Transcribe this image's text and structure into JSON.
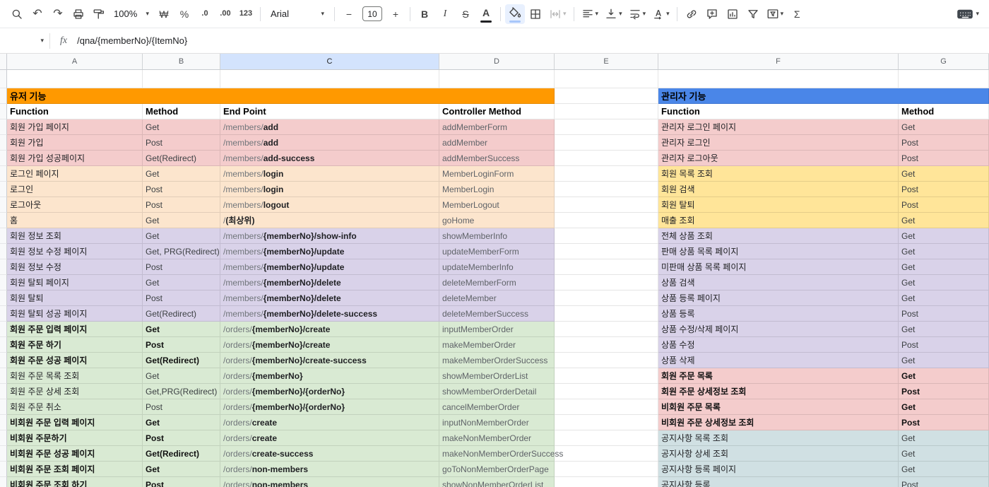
{
  "toolbar": {
    "items": [
      {
        "name": "search",
        "icon": "search"
      },
      {
        "name": "undo",
        "glyph": "↶",
        "cls": "arrow"
      },
      {
        "name": "redo",
        "glyph": "↷",
        "cls": "arrow"
      },
      {
        "name": "print",
        "icon": "print"
      },
      {
        "name": "paint-format",
        "icon": "roller"
      },
      {
        "name": "zoom",
        "label": "100%",
        "dropdown": true,
        "zoom": true
      },
      {
        "name": "format-currency",
        "glyph": "₩"
      },
      {
        "name": "format-percent",
        "glyph": "%"
      },
      {
        "name": "decrease-decimal-places",
        "glyph": ".0",
        "cls": "small"
      },
      {
        "name": "increase-decimal-places",
        "glyph": ".00",
        "cls": "small"
      },
      {
        "name": "more-formats",
        "glyph": "123",
        "cls": "small"
      },
      {
        "type": "sep"
      },
      {
        "name": "font-family",
        "label": "Arial",
        "dropdown": true,
        "wide": true
      },
      {
        "type": "sep"
      },
      {
        "name": "decrease-font-size",
        "glyph": "−"
      },
      {
        "name": "font-size",
        "box": "10"
      },
      {
        "name": "increase-font-size",
        "glyph": "+"
      },
      {
        "type": "sep"
      },
      {
        "name": "bold",
        "glyph": "B",
        "cls": "b"
      },
      {
        "name": "italic",
        "glyph": "I",
        "cls": "i"
      },
      {
        "name": "strikethrough",
        "glyph": "S",
        "cls": "s"
      },
      {
        "name": "text-color",
        "glyph": "A",
        "cls": "b",
        "bar": "#202124"
      },
      {
        "type": "sep"
      },
      {
        "name": "fill-color",
        "icon": "fill",
        "bar": "#a8c7fa",
        "active": true
      },
      {
        "name": "borders",
        "icon": "borders"
      },
      {
        "name": "merge-cells",
        "icon": "merge",
        "dropdown": true,
        "disabled": true
      },
      {
        "type": "sep"
      },
      {
        "name": "horizontal-align",
        "icon": "align-left",
        "dropdown": true
      },
      {
        "name": "vertical-align",
        "icon": "valign",
        "dropdown": true
      },
      {
        "name": "text-wrap",
        "icon": "wrap",
        "dropdown": true
      },
      {
        "name": "text-rotation",
        "icon": "rotate",
        "dropdown": true
      },
      {
        "type": "sep"
      },
      {
        "name": "insert-link",
        "icon": "link"
      },
      {
        "name": "insert-comment",
        "icon": "comment"
      },
      {
        "name": "insert-chart",
        "icon": "chart"
      },
      {
        "name": "create-filter",
        "icon": "filter"
      },
      {
        "name": "filter-views",
        "icon": "filter-views",
        "dropdown": true
      },
      {
        "name": "functions",
        "glyph": "Σ"
      },
      {
        "type": "spacer"
      },
      {
        "name": "input-tools",
        "icon": "keyboard",
        "dropdown": true
      }
    ]
  },
  "formula_bar": {
    "fx_label": "fx",
    "value": "/qna/{memberNo}/{ItemNo}"
  },
  "grid": {
    "columns": [
      "A",
      "B",
      "C",
      "D",
      "E",
      "F",
      "G"
    ],
    "selected_column": "C"
  },
  "left_table": {
    "section_title": "유저 기능",
    "section_color": "#ff9900",
    "headers": [
      "Function",
      "Method",
      "End Point",
      "Controller Method"
    ],
    "rows": [
      {
        "function": "회원 가입 페이지",
        "method": "Get",
        "endpoint_prefix": "/members/",
        "endpoint_main": "add",
        "controller": "addMemberForm",
        "color": "#f4cccc"
      },
      {
        "function": "회원 가입",
        "method": "Post",
        "endpoint_prefix": "/members/",
        "endpoint_main": "add",
        "controller": "addMember",
        "color": "#f4cccc"
      },
      {
        "function": "회원 가입 성공페이지",
        "method": "Get(Redirect)",
        "endpoint_prefix": "/members/",
        "endpoint_main": "add-success",
        "controller": "addMemberSuccess",
        "color": "#f4cccc"
      },
      {
        "function": "로그인 페이지",
        "method": "Get",
        "endpoint_prefix": "/members/",
        "endpoint_main": "login",
        "controller": "MemberLoginForm",
        "color": "#fce5cd"
      },
      {
        "function": "로그인",
        "method": "Post",
        "endpoint_prefix": "/members/",
        "endpoint_main": "login",
        "controller": "MemberLogin",
        "color": "#fce5cd"
      },
      {
        "function": "로그아웃",
        "method": "Post",
        "endpoint_prefix": "/members/",
        "endpoint_main": "logout",
        "controller": "MemberLogout",
        "color": "#fce5cd"
      },
      {
        "function": "홈",
        "method": "Get",
        "endpoint_prefix": "/ ",
        "endpoint_main": "(최상위)",
        "controller": "goHome",
        "color": "#fce5cd"
      },
      {
        "function": "회원 정보 조회",
        "method": "Get",
        "endpoint_prefix": "/members/",
        "endpoint_main": "{memberNo}/show-info",
        "controller": "showMemberInfo",
        "color": "#d9d2e9"
      },
      {
        "function": "회원 정보 수정 페이지",
        "method": "Get, PRG(Redirect)",
        "endpoint_prefix": "/members/",
        "endpoint_main": "{memberNo}/update",
        "controller": "updateMemberForm",
        "color": "#d9d2e9"
      },
      {
        "function": "회원 정보 수정",
        "method": "Post",
        "endpoint_prefix": "/members/",
        "endpoint_main": "{memberNo}/update",
        "controller": "updateMemberInfo",
        "color": "#d9d2e9"
      },
      {
        "function": "회원 탈퇴 페이지",
        "method": "Get",
        "endpoint_prefix": "/members/",
        "endpoint_main": "{memberNo}/delete",
        "controller": "deleteMemberForm",
        "color": "#d9d2e9"
      },
      {
        "function": "회원 탈퇴",
        "method": "Post",
        "endpoint_prefix": "/members/",
        "endpoint_main": "{memberNo}/delete",
        "controller": "deleteMember",
        "color": "#d9d2e9"
      },
      {
        "function": "회원 탈퇴 성공 페이지",
        "method": "Get(Redirect)",
        "endpoint_prefix": "/members/",
        "endpoint_main": "{memberNo}/delete-success",
        "controller": "deleteMemberSuccess",
        "color": "#d9d2e9"
      },
      {
        "function": "회원 주문 입력 페이지",
        "method": "Get",
        "endpoint_prefix": "/orders/",
        "endpoint_main": "{memberNo}/create",
        "controller": "inputMemberOrder",
        "color": "#d9ead3",
        "bold": true
      },
      {
        "function": "회원 주문 하기",
        "method": "Post",
        "endpoint_prefix": "/orders/",
        "endpoint_main": "{memberNo}/create",
        "controller": "makeMemberOrder",
        "color": "#d9ead3",
        "bold": true
      },
      {
        "function": "회원 주문 성공 페이지",
        "method": "Get(Redirect)",
        "endpoint_prefix": "/orders/",
        "endpoint_main": "{memberNo}/create-success",
        "controller": "makeMemberOrderSuccess",
        "color": "#d9ead3",
        "bold": true
      },
      {
        "function": "회원 주문 목록 조회",
        "method": "Get",
        "endpoint_prefix": "/orders/",
        "endpoint_main": "{memberNo}",
        "controller": "showMemberOrderList",
        "color": "#d9ead3"
      },
      {
        "function": "회원 주문 상세 조회",
        "method": "Get,PRG(Redirect)",
        "endpoint_prefix": "/orders/",
        "endpoint_main": "{memberNo}/{orderNo}",
        "controller": "showMemberOrderDetail",
        "color": "#d9ead3"
      },
      {
        "function": "회원 주문 취소",
        "method": "Post",
        "endpoint_prefix": "/orders/",
        "endpoint_main": "{memberNo}/{orderNo}",
        "controller": "cancelMemberOrder",
        "color": "#d9ead3"
      },
      {
        "function": "비회원 주문 입력 페이지",
        "method": "Get",
        "endpoint_prefix": "/orders/",
        "endpoint_main": "create",
        "controller": "inputNonMemberOrder",
        "color": "#d9ead3",
        "bold": true
      },
      {
        "function": "비회원 주문하기",
        "method": "Post",
        "endpoint_prefix": "/orders/",
        "endpoint_main": "create",
        "controller": "makeNonMemberOrder",
        "color": "#d9ead3",
        "bold": true
      },
      {
        "function": "비회원 주문 성공 페이지",
        "method": "Get(Redirect)",
        "endpoint_prefix": "/orders/",
        "endpoint_main": "create-success",
        "controller": "makeNonMemberOrderSuccess",
        "color": "#d9ead3",
        "bold": true
      },
      {
        "function": "비회원 주문 조회 페이지",
        "method": "Get",
        "endpoint_prefix": "/orders/",
        "endpoint_main": "non-members",
        "controller": "goToNonMemberOrderPage",
        "color": "#d9ead3",
        "bold": true
      },
      {
        "function": "비회원 주문 조회 하기",
        "method": "Post",
        "endpoint_prefix": "/orders/",
        "endpoint_main": "non-members",
        "controller": "showNonMemberOrderList",
        "color": "#d9ead3",
        "bold": true
      }
    ]
  },
  "right_table": {
    "section_title": "관리자 기능",
    "section_color": "#4a86e8",
    "headers": [
      "Function",
      "Method"
    ],
    "rows": [
      {
        "function": "관리자 로그인 페이지",
        "method": "Get",
        "color": "#f4cccc"
      },
      {
        "function": "관리자 로그인",
        "method": "Post",
        "color": "#f4cccc"
      },
      {
        "function": "관리자 로그아웃",
        "method": "Post",
        "color": "#f4cccc"
      },
      {
        "function": "회원 목록 조회",
        "method": "Get",
        "color": "#ffe599"
      },
      {
        "function": "회원 검색",
        "method": "Post",
        "color": "#ffe599"
      },
      {
        "function": "회원 탈퇴",
        "method": "Post",
        "color": "#ffe599"
      },
      {
        "function": "매출 조회",
        "method": "Get",
        "color": "#ffe599"
      },
      {
        "function": "전체 상품 조회",
        "method": "Get",
        "color": "#d9d2e9"
      },
      {
        "function": "판매 상품 목록 페이지",
        "method": "Get",
        "color": "#d9d2e9"
      },
      {
        "function": "미판매 상품 목록 페이지",
        "method": "Get",
        "color": "#d9d2e9"
      },
      {
        "function": "상품 검색",
        "method": "Get",
        "color": "#d9d2e9"
      },
      {
        "function": "상품 등록 페이지",
        "method": "Get",
        "color": "#d9d2e9"
      },
      {
        "function": "상품 등록",
        "method": "Post",
        "color": "#d9d2e9"
      },
      {
        "function": "상품 수정/삭제 페이지",
        "method": "Get",
        "color": "#d9d2e9"
      },
      {
        "function": "상품 수정",
        "method": "Post",
        "color": "#d9d2e9"
      },
      {
        "function": "상품 삭제",
        "method": "Get",
        "color": "#d9d2e9"
      },
      {
        "function": "회원 주문 목록",
        "method": "Get",
        "color": "#f4cccc",
        "bold": true
      },
      {
        "function": "회원 주문 상세정보 조회",
        "method": "Post",
        "color": "#f4cccc",
        "bold": true
      },
      {
        "function": "비회원 주문 목록",
        "method": "Get",
        "color": "#f4cccc",
        "bold": true
      },
      {
        "function": "비회원 주문 상세정보 조회",
        "method": "Post",
        "color": "#f4cccc",
        "bold": true
      },
      {
        "function": "공지사항 목록 조회",
        "method": "Get",
        "color": "#d0e0e3"
      },
      {
        "function": "공지사항 상세 조회",
        "method": "Get",
        "color": "#d0e0e3"
      },
      {
        "function": "공지사항 등록 페이지",
        "method": "Get",
        "color": "#d0e0e3"
      },
      {
        "function": "공지사항 등록",
        "method": "Post",
        "color": "#d0e0e3"
      }
    ]
  }
}
